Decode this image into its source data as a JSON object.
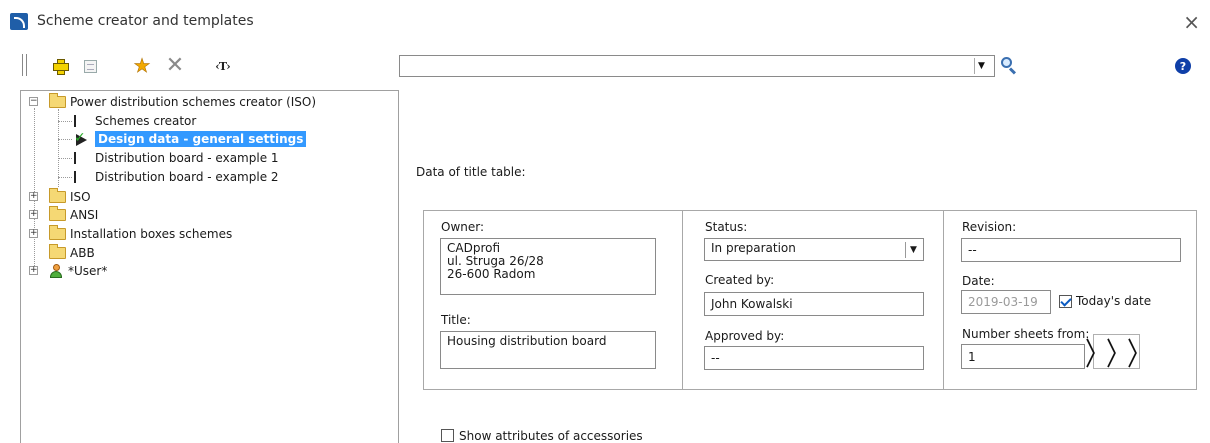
{
  "window": {
    "title": "Scheme creator and templates",
    "close_glyph": "×"
  },
  "toolbar": {
    "text_tool_label": "‹T›",
    "search_value": "",
    "help_glyph": "?"
  },
  "tree": {
    "root": "Power distribution schemes creator (ISO)",
    "children": [
      "Schemes creator",
      "Design data - general settings",
      "Distribution board - example 1",
      "Distribution board - example 2"
    ],
    "groups": [
      "ISO",
      "ANSI",
      "Installation boxes schemes",
      "ABB",
      "*User*"
    ],
    "selected": "Design data - general settings"
  },
  "form": {
    "section_label": "Data of title table:",
    "owner_label": "Owner:",
    "owner_value": "CADprofi\nul. Struga 26/28\n26-600 Radom",
    "title_label": "Title:",
    "title_value": "Housing distribution board",
    "status_label": "Status:",
    "status_value": "In preparation",
    "created_by_label": "Created by:",
    "created_by_value": "John Kowalski",
    "approved_by_label": "Approved by:",
    "approved_by_value": "--",
    "revision_label": "Revision:",
    "revision_value": "--",
    "date_label": "Date:",
    "date_value": "2019-03-19",
    "todays_date_label": "Today's date",
    "todays_date_checked": true,
    "number_sheets_label": "Number sheets from:",
    "number_sheets_value": "1",
    "next_glyph": "〉〉〉",
    "show_attributes_label": "Show attributes of accessories",
    "show_attributes_checked": false
  }
}
